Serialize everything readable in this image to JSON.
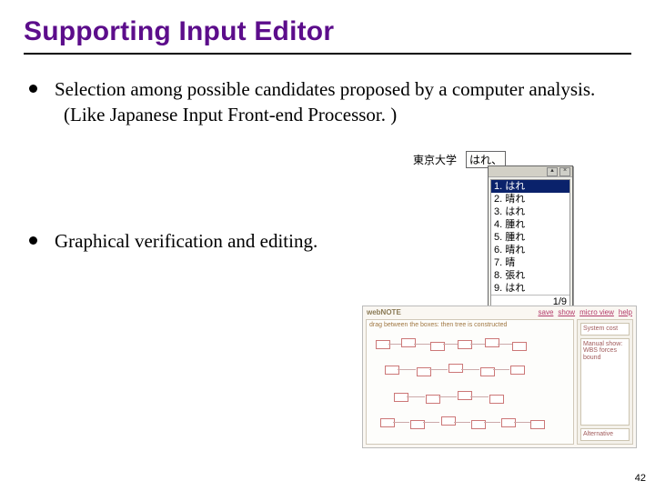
{
  "title": "Supporting Input Editor",
  "bullets": [
    {
      "text": "Selection among possible candidates proposed by a computer analysis.",
      "sub": "(Like Japanese Input Front-end Processor. )"
    },
    {
      "text": "Graphical verification and editing."
    }
  ],
  "ime": {
    "context_left": "東京大学",
    "context_right": "はれ、",
    "candidates": [
      "1. はれ",
      "2. 晴れ",
      "3. はれ",
      "4. 腫れ",
      "5. 腫れ",
      "6. 晴れ",
      "7. 晴",
      "8. 張れ",
      "9. はれ"
    ],
    "selected_index": 0,
    "footer": "1/9"
  },
  "editor": {
    "logo": "webNOTE",
    "toolbar_items": [
      "save",
      "show",
      "micro view",
      "help"
    ],
    "canvas_hint": "drag between the boxes: then tree is constructed",
    "sidebar_panels": [
      "System cost",
      "Manual show:\nWBS forces bound",
      "Alternative"
    ]
  },
  "page_number": "42"
}
